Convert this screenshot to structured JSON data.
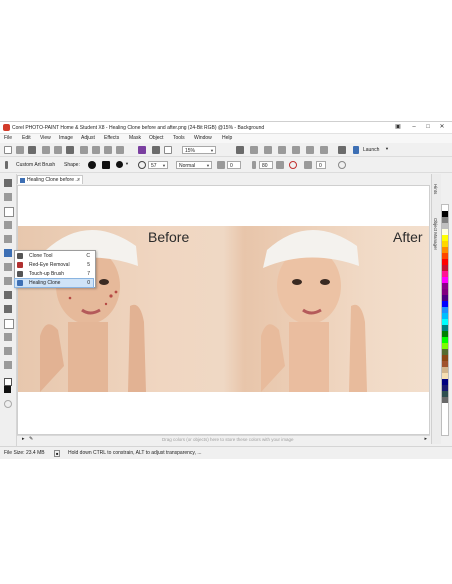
{
  "window": {
    "title": "Corel PHOTO-PAINT Home & Student X8 - Healing Clone before and after.png (24-Bit RGB) @15% - Background"
  },
  "menu": [
    "File",
    "Edit",
    "View",
    "Image",
    "Adjust",
    "Effects",
    "Mask",
    "Object",
    "Tools",
    "Window",
    "Help"
  ],
  "toolbar1": {
    "zoom_value": "15%",
    "launch_label": "Launch"
  },
  "toolbar2": {
    "brush_label": "Custom Art Brush",
    "shape_label": "Shape:",
    "size_value": "57",
    "merge_mode": "Normal",
    "transparency_value": "0",
    "opacity_value": "80",
    "extra_value": "0"
  },
  "document": {
    "tab_label": "Healing Clone before ...",
    "before_label": "Before",
    "after_label": "After",
    "drag_hint": "Drag colors (or objects) here to store these colors with your image"
  },
  "flyout": {
    "items": [
      {
        "label": "Clone Tool",
        "key": "C"
      },
      {
        "label": "Red-Eye Removal",
        "key": "5"
      },
      {
        "label": "Touch-up Brush",
        "key": "7"
      },
      {
        "label": "Healing Clone",
        "key": "0"
      }
    ]
  },
  "dock_tabs": {
    "hints": "Hints",
    "object_manager": "Object Manager"
  },
  "status": {
    "file_size": "File Size: 23.4 MB",
    "hint": "Hold down CTRL to constrain, ALT to adjust transparency, ..."
  },
  "palette_colors": [
    "#ffffff",
    "#000000",
    "#808080",
    "#c0c0c0",
    "#ffffe0",
    "#ffff00",
    "#ffd700",
    "#ff8c00",
    "#ff4500",
    "#ff0000",
    "#c8102e",
    "#ff1493",
    "#ff00ff",
    "#8b008b",
    "#800080",
    "#4b0082",
    "#0000ff",
    "#1e90ff",
    "#00bfff",
    "#00ffff",
    "#008080",
    "#008000",
    "#00ff00",
    "#7cfc00",
    "#556b2f",
    "#8b4513",
    "#a0522d",
    "#d2b48c",
    "#f5deb3",
    "#000080",
    "#191970",
    "#2f4f4f",
    "#696969"
  ]
}
